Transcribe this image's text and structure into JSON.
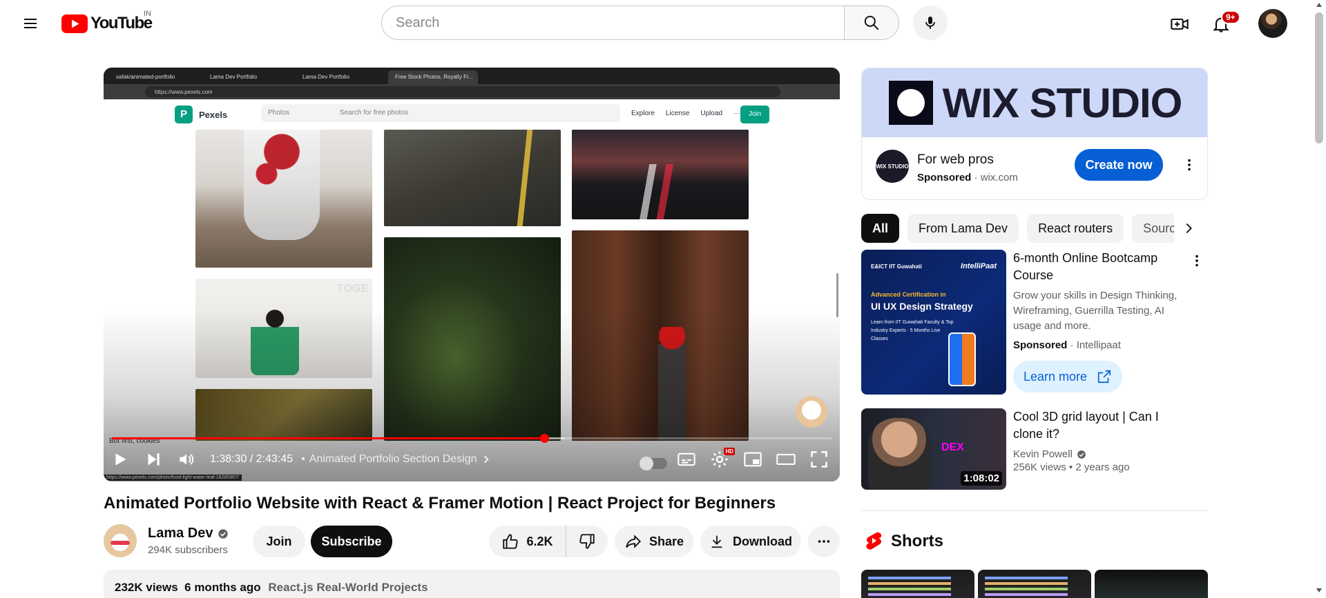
{
  "masthead": {
    "logo_text": "YouTube",
    "region": "IN",
    "search_placeholder": "Search",
    "notifications_badge": "9+"
  },
  "player": {
    "browser_tabs": [
      "safak/animated-portfolio",
      "Lama Dev Portfolio",
      "Lama Dev Portfolio",
      "Free Stock Photos, Royalty Fr..."
    ],
    "browser_url": "https://www.pexels.com",
    "pexels": {
      "name": "Pexels",
      "logo_letter": "P",
      "photos_menu": "Photos",
      "search_placeholder": "Search for free photos",
      "nav": [
        "Explore",
        "License",
        "Upload",
        "···"
      ],
      "join": "Join",
      "watermark": "TOGE"
    },
    "cookie_text": "But first, cookies",
    "status_url": "https://www.pexels.com/photo/food-light-water-leaf-16285967/",
    "current_time": "1:38:30",
    "duration": "2:43:45",
    "time_display": "1:38:30 / 2:43:45",
    "chapter": "Animated Portfolio Section Design",
    "progress_fraction": 0.601,
    "loaded_fraction": 0.63,
    "hd_badge": "HD"
  },
  "video": {
    "title": "Animated Portfolio Website with React & Framer Motion | React Project for Beginners",
    "channel_name": "Lama Dev",
    "subscribers": "294K subscribers",
    "join_label": "Join",
    "subscribe_label": "Subscribe",
    "likes": "6.2K",
    "share_label": "Share",
    "download_label": "Download",
    "views": "232K views",
    "age": "6 months ago",
    "playlist": "React.js Real-World Projects"
  },
  "sidebar": {
    "ad": {
      "banner_text": "WIX STUDIO",
      "logo_text": "WIX STUDIO",
      "title": "For web pros",
      "sponsored": "Sponsored",
      "domain": "wix.com",
      "cta": "Create now"
    },
    "chips": [
      "All",
      "From Lama Dev",
      "React routers",
      "Source"
    ],
    "recommendations": [
      {
        "title": "6-month Online Bootcamp Course",
        "description": "Grow your skills in Design Thinking, Wireframing, Guerrilla Testing, AI usage and more.",
        "sponsored": "Sponsored",
        "advertiser": "Intellipaat",
        "cta": "Learn more",
        "thumb_top": "E&ICT IIT Guwahati",
        "thumb_brand": "IntelliPaat",
        "thumb_sub": "Advanced Certification in",
        "thumb_head": "UI UX Design Strategy",
        "thumb_list": "Learn from IIT Guwahati Faculty & Top Industry Experts · 5 Months Live Classes"
      },
      {
        "title": "Cool 3D grid layout | Can I clone it?",
        "channel": "Kevin Powell",
        "views": "256K views",
        "age": "2 years ago",
        "duration": "1:08:02",
        "thumb_text": "DEX"
      }
    ],
    "shorts_title": "Shorts"
  },
  "colors": {
    "brand_red": "#ff0000",
    "link_blue": "#065fd4",
    "pexels_green": "#05a081"
  }
}
